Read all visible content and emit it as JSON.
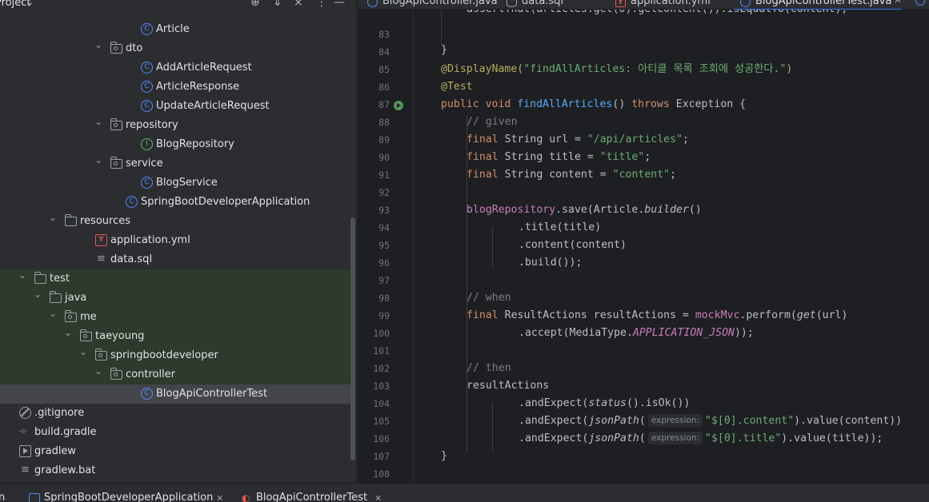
{
  "project": {
    "title": "Project",
    "icons": [
      "target-icon",
      "expand-collapse-icon",
      "collapse-all-icon",
      "more-icon",
      "minimize-icon"
    ],
    "tree": [
      {
        "label": "Article",
        "icon": "class",
        "depth": 8,
        "chev": ""
      },
      {
        "label": "dto",
        "icon": "package",
        "depth": 6,
        "chev": "v"
      },
      {
        "label": "AddArticleRequest",
        "icon": "class",
        "depth": 8,
        "chev": ""
      },
      {
        "label": "ArticleResponse",
        "icon": "class",
        "depth": 8,
        "chev": ""
      },
      {
        "label": "UpdateArticleRequest",
        "icon": "class",
        "depth": 8,
        "chev": ""
      },
      {
        "label": "repository",
        "icon": "package",
        "depth": 6,
        "chev": "v"
      },
      {
        "label": "BlogRepository",
        "icon": "interface",
        "depth": 8,
        "chev": ""
      },
      {
        "label": "service",
        "icon": "package",
        "depth": 6,
        "chev": "v"
      },
      {
        "label": "BlogService",
        "icon": "class",
        "depth": 8,
        "chev": ""
      },
      {
        "label": "SpringBootDeveloperApplication",
        "icon": "class",
        "depth": 7,
        "chev": ""
      },
      {
        "label": "resources",
        "icon": "folder",
        "depth": 3,
        "chev": "v"
      },
      {
        "label": "application.yml",
        "icon": "yaml",
        "depth": 5,
        "chev": ""
      },
      {
        "label": "data.sql",
        "icon": "text",
        "depth": 5,
        "chev": ""
      },
      {
        "label": "test",
        "icon": "folder",
        "depth": 1,
        "chev": "v"
      },
      {
        "label": "java",
        "icon": "folder",
        "depth": 2,
        "chev": "v"
      },
      {
        "label": "me",
        "icon": "package",
        "depth": 3,
        "chev": "v"
      },
      {
        "label": "taeyoung",
        "icon": "package",
        "depth": 4,
        "chev": "v"
      },
      {
        "label": "springbootdeveloper",
        "icon": "package",
        "depth": 5,
        "chev": "v"
      },
      {
        "label": "controller",
        "icon": "package",
        "depth": 6,
        "chev": "v"
      },
      {
        "label": "BlogApiControllerTest",
        "icon": "class",
        "depth": 8,
        "chev": ""
      },
      {
        "label": ".gitignore",
        "icon": "ignore",
        "depth": 0,
        "chev": ""
      },
      {
        "label": "build.gradle",
        "icon": "gradle",
        "depth": 0,
        "chev": ""
      },
      {
        "label": "gradlew",
        "icon": "exec",
        "depth": 0,
        "chev": ""
      },
      {
        "label": "gradlew.bat",
        "icon": "text",
        "depth": 0,
        "chev": ""
      }
    ]
  },
  "tabs": [
    {
      "label": "BlogApiController.java",
      "icon": "class",
      "active": false
    },
    {
      "label": "data.sql",
      "icon": "sql",
      "active": false
    },
    {
      "label": "application.yml",
      "icon": "yaml",
      "active": false
    },
    {
      "label": "BlogApiControllerTest.java",
      "icon": "class",
      "active": true
    }
  ],
  "editor": {
    "line_numbers": [
      "83",
      "84",
      "85",
      "86",
      "87",
      "88",
      "89",
      "90",
      "91",
      "92",
      "93",
      "94",
      "95",
      "96",
      "97",
      "98",
      "99",
      "100",
      "101",
      "102",
      "103",
      "104",
      "105",
      "106",
      "107",
      "108"
    ],
    "hint_label": "expression:",
    "code": {
      "l84": "}",
      "l85_ann": "@DisplayName(",
      "l85_str": "\"findAllArticles: 아티클 목록 조회에 성공한다.\"",
      "l85_end": ")",
      "l86": "@Test",
      "l87_kw1": "public void ",
      "l87_fn": "findAllArticles",
      "l87_mid": "() ",
      "l87_kw2": "throws ",
      "l87_end": "Exception {",
      "l88": "// given",
      "l89_kw": "final ",
      "l89_mid": "String url = ",
      "l89_str": "\"/api/articles\"",
      "l90_kw": "final ",
      "l90_mid": "String title = ",
      "l90_str": "\"title\"",
      "l91_kw": "final ",
      "l91_mid": "String content = ",
      "l91_str": "\"content\"",
      "semi": ";",
      "l93_fld": "blogRepository",
      "l93_mid": ".save(Article.",
      "l93_it": "builder",
      "l93_end": "()",
      "l94": ".title(title)",
      "l95": ".content(content)",
      "l96": ".build());",
      "l98": "// when",
      "l99_kw": "final ",
      "l99_mid": "ResultActions resultActions = ",
      "l99_fld": "mockMvc",
      "l99_mid2": ".perform(",
      "l99_it": "get",
      "l99_end": "(url)",
      "l100_a": ".accept(MediaType.",
      "l100_cst": "APPLICATION_JSON",
      "l100_end": "));",
      "l102": "// then",
      "l103": "resultActions",
      "l104_a": ".andExpect(",
      "l104_it": "status",
      "l104_end": "().isOk())",
      "l105_a": ".andExpect(",
      "l105_it": "jsonPath",
      "l105_b": "(",
      "l105_str": "\"$[0].content\"",
      "l105_end": ").value(content))",
      "l106_a": ".andExpect(",
      "l106_it": "jsonPath",
      "l106_b": "(",
      "l106_str": "\"$[0].title\"",
      "l106_end": ").value(title));",
      "l107": "}"
    }
  },
  "bottom_tabs": [
    {
      "label": "SpringBootDeveloperApplication"
    },
    {
      "label": "BlogApiControllerTest"
    }
  ],
  "bottom_left": "n",
  "colors": {
    "accent": "#3574f0",
    "class_icon": "#548af7",
    "interface_icon": "#5fb865",
    "test_bg": "#2d3a2c"
  }
}
